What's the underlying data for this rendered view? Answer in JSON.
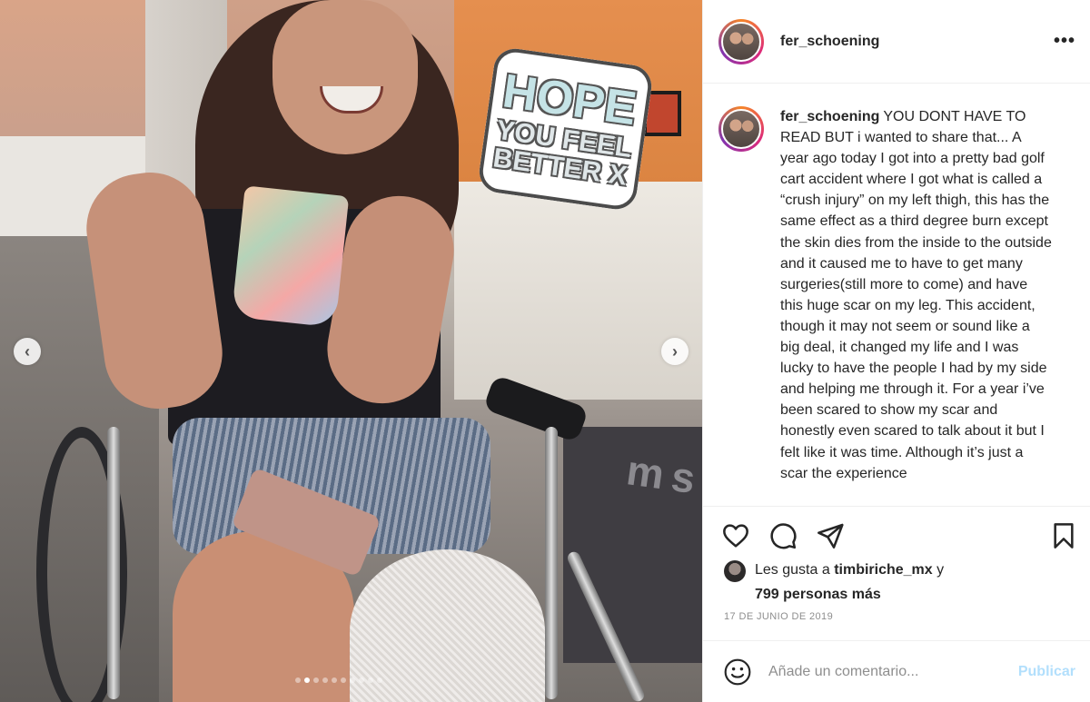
{
  "post": {
    "username": "fer_schoening",
    "caption": "YOU DONT HAVE TO READ BUT i wanted to share that... A year ago today I got into a pretty bad golf cart accident where I got what is called a “crush injury” on my left thigh, this has the same effect as a third degree burn except the skin dies from the inside to the outside and it caused me to have to get many surgeries(still more to come) and have this huge scar on my leg. This accident, though it may not seem or sound like a big deal, it changed my life and I was lucky to have the people I had by my side and helping me through it. For a year i’ve been scared to show my scar and honestly even scared to talk about it but I felt like it was time. Although it’s just a scar the experience",
    "likes_prefix": "Les gusta a",
    "likes_user": "timbiriche_mx",
    "likes_joiner": "y",
    "likes_others": "799 personas más",
    "date": "17 DE JUNIO DE 2019",
    "comment_placeholder": "Añade un comentario...",
    "publish_label": "Publicar",
    "more_label": "•••"
  },
  "photo": {
    "sticker_line1": "HOPE",
    "sticker_line2": "YOU FEEL",
    "sticker_line3": "BETTER X",
    "mat_text": "m s",
    "carousel_total": 10,
    "carousel_active": 2,
    "prev_label": "‹",
    "next_label": "›"
  },
  "icons": {
    "like": "heart-icon",
    "comment": "comment-icon",
    "share": "share-icon",
    "save": "bookmark-icon",
    "emoji": "emoji-icon",
    "more": "more-options-icon"
  },
  "colors": {
    "text": "#262626",
    "muted": "#8e8e8e",
    "publish_disabled": "#b2dffc",
    "border": "#efefef"
  }
}
